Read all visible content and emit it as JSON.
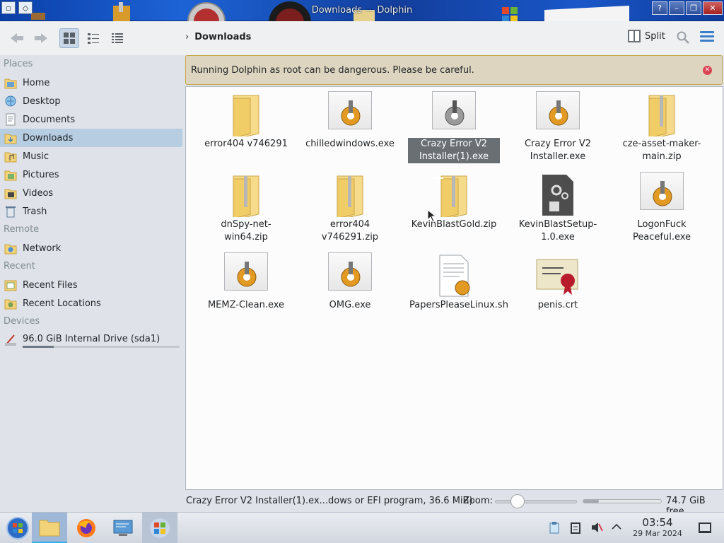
{
  "window": {
    "title": "Downloads — Dolphin"
  },
  "toolbar": {
    "breadcrumb": [
      "Downloads"
    ],
    "split_label": "Split"
  },
  "sidebar": {
    "sections": [
      {
        "header": "Places",
        "items": [
          {
            "label": "Home",
            "icon": "home-folder-icon"
          },
          {
            "label": "Desktop",
            "icon": "desktop-icon"
          },
          {
            "label": "Documents",
            "icon": "documents-icon"
          },
          {
            "label": "Downloads",
            "icon": "downloads-folder-icon",
            "active": true
          },
          {
            "label": "Music",
            "icon": "music-folder-icon"
          },
          {
            "label": "Pictures",
            "icon": "pictures-icon"
          },
          {
            "label": "Videos",
            "icon": "videos-icon"
          },
          {
            "label": "Trash",
            "icon": "trash-icon"
          }
        ]
      },
      {
        "header": "Remote",
        "items": [
          {
            "label": "Network",
            "icon": "network-folder-icon"
          }
        ]
      },
      {
        "header": "Recent",
        "items": [
          {
            "label": "Recent Files",
            "icon": "recent-files-icon"
          },
          {
            "label": "Recent Locations",
            "icon": "recent-locations-icon"
          }
        ]
      },
      {
        "header": "Devices",
        "items": [
          {
            "label": "96.0 GiB Internal Drive (sda1)",
            "icon": "drive-icon",
            "usage": 0.2
          }
        ]
      }
    ]
  },
  "warning": {
    "text": "Running Dolphin as root can be dangerous. Please be careful."
  },
  "files": [
    {
      "name": "error404 v746291",
      "type": "folder"
    },
    {
      "name": "chilledwindows.exe",
      "type": "exe"
    },
    {
      "name": "Crazy Error V2 Installer(1).exe",
      "type": "exe",
      "selected": true
    },
    {
      "name": "Crazy Error V2 Installer.exe",
      "type": "exe"
    },
    {
      "name": "cze-asset-maker-main.zip",
      "type": "zip"
    },
    {
      "name": "dnSpy-net-win64.zip",
      "type": "zip"
    },
    {
      "name": "error404 v746291.zip",
      "type": "zip"
    },
    {
      "name": "KevinBlastGold.zip",
      "type": "zip"
    },
    {
      "name": "KevinBlastSetup-1.0.exe",
      "type": "setup"
    },
    {
      "name": "LogonFuck Peaceful.exe",
      "type": "exe"
    },
    {
      "name": "MEMZ-Clean.exe",
      "type": "exe"
    },
    {
      "name": "OMG.exe",
      "type": "exe"
    },
    {
      "name": "PapersPleaseLinux.sh",
      "type": "script"
    },
    {
      "name": "penis.crt",
      "type": "cert"
    }
  ],
  "statusbar": {
    "status_text": "Crazy Error V2 Installer(1).ex...dows or EFI program, 36.6 MiB)",
    "zoom_label": "Zoom:",
    "zoom_level": 0.25,
    "free_space": "74.7 GiB free",
    "used_fraction": 0.2
  },
  "taskbar": {
    "apps": [
      "start-menu-icon",
      "file-manager-icon",
      "firefox-icon",
      "system-settings-icon",
      "windows-app-icon"
    ],
    "time": "03:54",
    "date": "29 Mar 2024"
  },
  "colors": {
    "accent": "#3daee9",
    "warning_bg": "#ddd5bf",
    "selection": "#6a6f74",
    "folder": "#f3d37a"
  }
}
